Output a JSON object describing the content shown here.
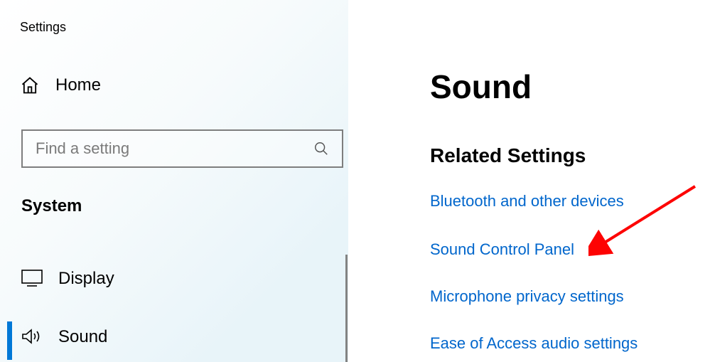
{
  "window": {
    "title": "Settings"
  },
  "sidebar": {
    "home_label": "Home",
    "search_placeholder": "Find a setting",
    "category_label": "System",
    "items": [
      {
        "label": "Display"
      },
      {
        "label": "Sound"
      }
    ]
  },
  "main": {
    "page_title": "Sound",
    "section_title": "Related Settings",
    "links": [
      "Bluetooth and other devices",
      "Sound Control Panel",
      "Microphone privacy settings",
      "Ease of Access audio settings"
    ]
  },
  "annotation": {
    "arrow_color": "#fd0303"
  }
}
